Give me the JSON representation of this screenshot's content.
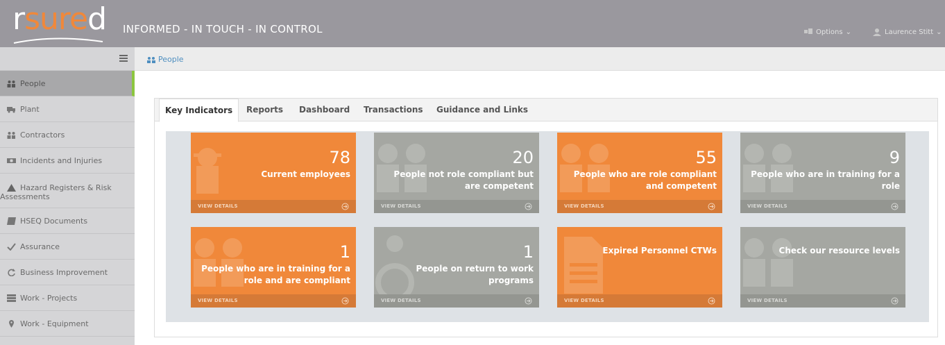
{
  "header": {
    "logo": {
      "r": "r",
      "sure": "sure",
      "d": "d"
    },
    "tagline": "INFORMED - IN TOUCH - IN CONTROL",
    "options_label": "Options",
    "user_label": "Laurence Stitt"
  },
  "breadcrumb": {
    "label": "People"
  },
  "sidebar": {
    "items": [
      {
        "label": "People",
        "icon": "people-icon",
        "active": true
      },
      {
        "label": "Plant",
        "icon": "truck-icon"
      },
      {
        "label": "Contractors",
        "icon": "people-icon"
      },
      {
        "label": "Incidents and Injuries",
        "icon": "ambulance-icon"
      },
      {
        "label": "Hazard Registers & Risk Assessments",
        "label_line1": "Hazard Registers & Risk",
        "label_line2": "Assessments",
        "icon": "warning-icon"
      },
      {
        "label": "HSEQ Documents",
        "icon": "book-icon"
      },
      {
        "label": "Assurance",
        "icon": "check-icon"
      },
      {
        "label": "Business Improvement",
        "icon": "refresh-icon"
      },
      {
        "label": "Work - Projects",
        "icon": "list-icon"
      },
      {
        "label": "Work - Equipment",
        "icon": "map-marker-icon"
      }
    ]
  },
  "tabs": [
    {
      "label": "Key Indicators",
      "active": true
    },
    {
      "label": "Reports"
    },
    {
      "label": "Dashboard"
    },
    {
      "label": "Transactions"
    },
    {
      "label": "Guidance and Links"
    }
  ],
  "tiles": [
    {
      "number": "78",
      "text": "Current employees",
      "color": "orange",
      "footer": "VIEW DETAILS"
    },
    {
      "number": "20",
      "text": "People not role compliant but are competent",
      "color": "gray",
      "footer": "VIEW DETAILS"
    },
    {
      "number": "55",
      "text": "People who are role compliant and competent",
      "color": "orange",
      "footer": "VIEW DETAILS"
    },
    {
      "number": "9",
      "text": "People who are in training for a role",
      "color": "gray",
      "footer": "VIEW DETAILS"
    },
    {
      "number": "1",
      "text": "People who are in training for a role and are compliant",
      "color": "orange",
      "footer": "VIEW DETAILS"
    },
    {
      "number": "1",
      "text": "People on return to work programs",
      "color": "gray",
      "footer": "VIEW DETAILS"
    },
    {
      "number": "",
      "text": "Expired Personnel CTWs",
      "color": "orange",
      "footer": "VIEW DETAILS"
    },
    {
      "number": "",
      "text": "Check our resource levels",
      "color": "gray",
      "footer": "VIEW DETAILS"
    }
  ],
  "colors": {
    "header_bg": "#9a989e",
    "accent_orange": "#f0883a",
    "tile_gray": "#a5a7a2",
    "active_marker": "#8cc63f",
    "link_blue": "#4f8fc0"
  }
}
